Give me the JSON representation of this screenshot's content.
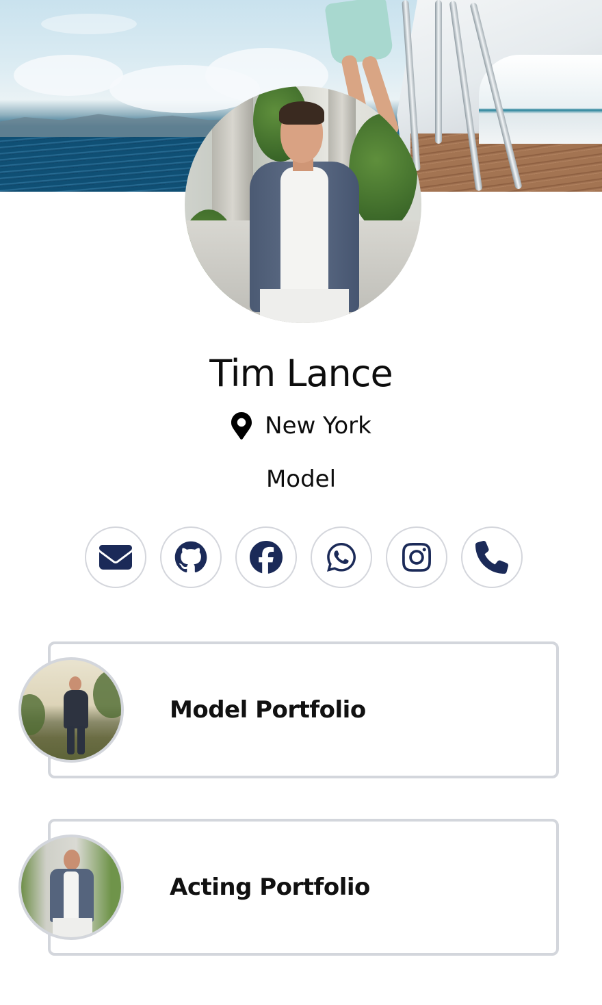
{
  "profile": {
    "name": "Tim Lance",
    "location": "New York",
    "role": "Model",
    "location_icon": "map-pin-icon",
    "cover_image": "ocean-yacht-cover",
    "avatar_image": "man-in-blazer-portrait"
  },
  "socials": [
    {
      "id": "email",
      "icon": "envelope-icon"
    },
    {
      "id": "github",
      "icon": "github-icon"
    },
    {
      "id": "facebook",
      "icon": "facebook-icon"
    },
    {
      "id": "whatsapp",
      "icon": "whatsapp-icon"
    },
    {
      "id": "instagram",
      "icon": "instagram-icon"
    },
    {
      "id": "phone",
      "icon": "phone-icon"
    }
  ],
  "links": [
    {
      "label": "Model Portfolio",
      "thumbnail": "model-portfolio-thumbnail"
    },
    {
      "label": "Acting Portfolio",
      "thumbnail": "acting-portfolio-thumbnail"
    }
  ],
  "colors": {
    "icon": "#1b2a58",
    "border": "#d3d6dc",
    "text": "#0d0d0d",
    "background": "#ffffff"
  }
}
